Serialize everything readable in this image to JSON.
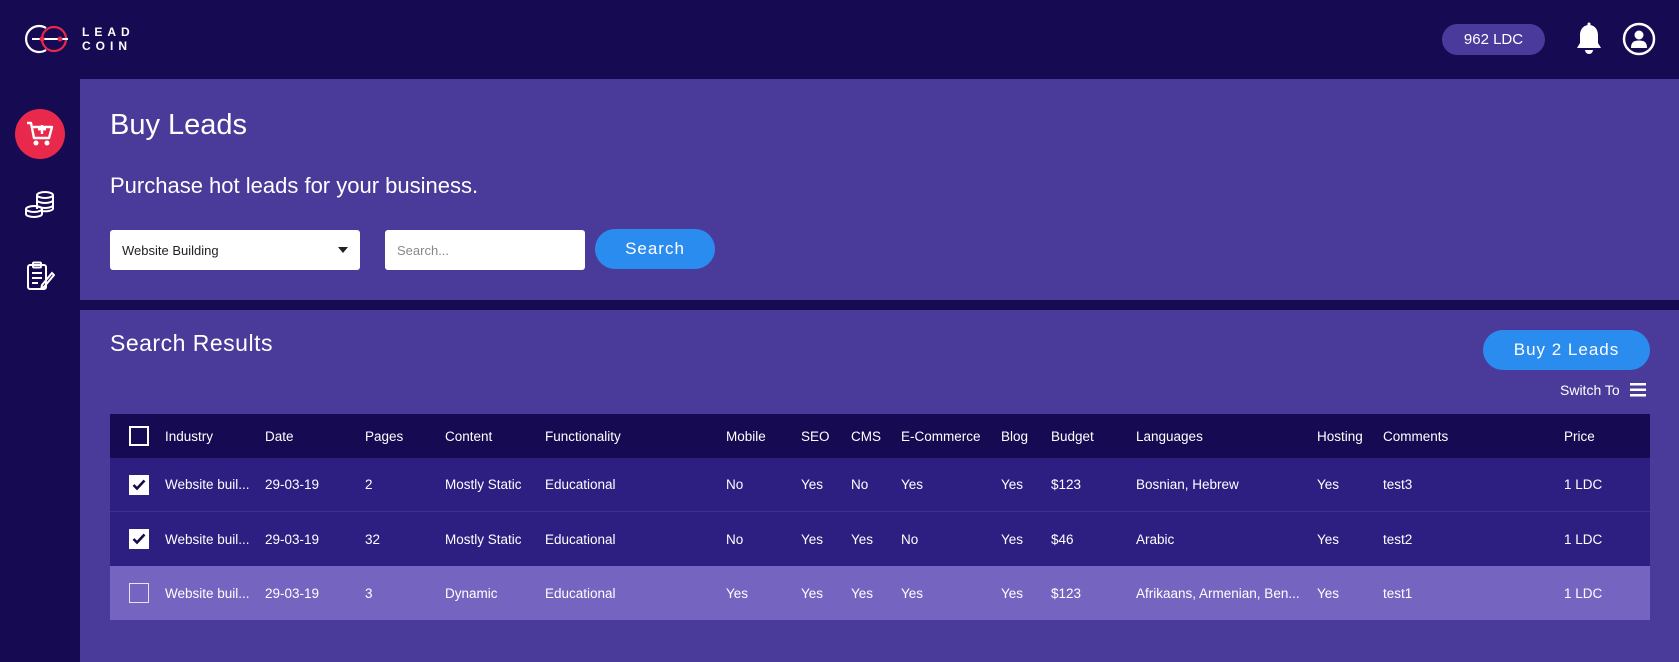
{
  "header": {
    "logo_text_line1": "LEAD",
    "logo_text_line2": "COIN",
    "balance": "962 LDC",
    "bell_icon": "bell-icon",
    "user_icon": "user-icon"
  },
  "sidebar": {
    "items": [
      {
        "icon": "cart-plus-icon",
        "active": true
      },
      {
        "icon": "coins-icon",
        "active": false
      },
      {
        "icon": "clipboard-edit-icon",
        "active": false
      }
    ]
  },
  "buy": {
    "title": "Buy Leads",
    "subtitle": "Purchase hot leads for your business.",
    "category_selected": "Website Building",
    "search_placeholder": "Search...",
    "search_button": "Search"
  },
  "results": {
    "title": "Search Results",
    "buy_button": "Buy 2 Leads",
    "switch_to": "Switch To",
    "columns": [
      "Industry",
      "Date",
      "Pages",
      "Content",
      "Functionality",
      "Mobile",
      "SEO",
      "CMS",
      "E-Commerce",
      "Blog",
      "Budget",
      "Languages",
      "Hosting",
      "Comments",
      "Price"
    ],
    "rows": [
      {
        "checked": true,
        "cells": [
          "Website buil...",
          "29-03-19",
          "2",
          "Mostly Static",
          "Educational",
          "No",
          "Yes",
          "No",
          "Yes",
          "Yes",
          "$123",
          "Bosnian, Hebrew",
          "Yes",
          "test3",
          "1 LDC"
        ]
      },
      {
        "checked": true,
        "cells": [
          "Website buil...",
          "29-03-19",
          "32",
          "Mostly Static",
          "Educational",
          "No",
          "Yes",
          "Yes",
          "No",
          "Yes",
          "$46",
          "Arabic",
          "Yes",
          "test2",
          "1 LDC"
        ]
      },
      {
        "checked": false,
        "cells": [
          "Website buil...",
          "29-03-19",
          "3",
          "Dynamic",
          "Educational",
          "Yes",
          "Yes",
          "Yes",
          "Yes",
          "Yes",
          "$123",
          "Afrikaans, Armenian, Ben...",
          "Yes",
          "test1",
          "1 LDC"
        ]
      }
    ]
  },
  "colors": {
    "background": "#160b52",
    "panel": "#4a3b9a",
    "row_dark": "#2d1f82",
    "row_highlight": "#7565c0",
    "accent_blue": "#2b8cf0",
    "accent_red": "#e8294c",
    "pill": "#4a3a9c"
  }
}
